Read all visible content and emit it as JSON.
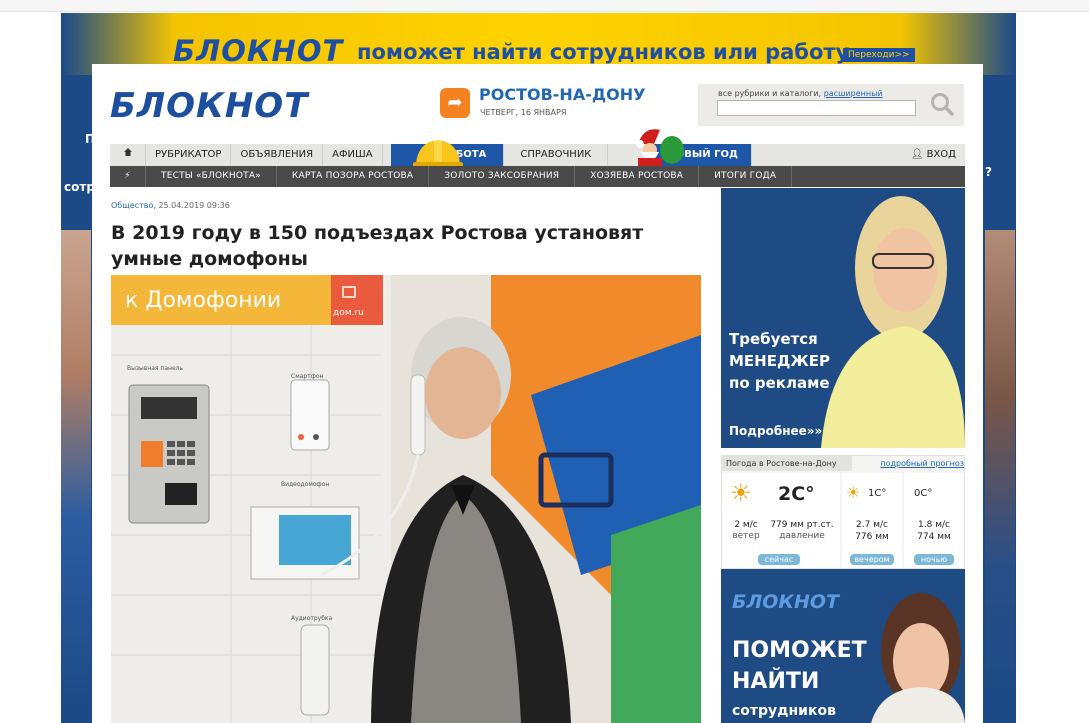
{
  "top_banner": {
    "logo": "БЛОКНОТ",
    "text": "поможет найти сотрудников или работу",
    "button": "Переходи>>"
  },
  "side_texts": {
    "left_1": "П",
    "left_2": "сотр",
    "right_1": "?"
  },
  "header": {
    "logo": "БЛОКНОТ",
    "city": "РОСТОВ-НА-ДОНУ",
    "date": "ЧЕТВЕРГ, 16 ЯНВАРЯ",
    "search_hint": "все рубрики и каталоги,",
    "search_link": "расширенный"
  },
  "nav1": {
    "items": [
      "РУБРИКАТОР",
      "ОБЪЯВЛЕНИЯ",
      "АФИША",
      "РАБОТА",
      "СПРАВОЧНИК",
      "НОВЫЙ ГОД",
      "ВХОД"
    ]
  },
  "nav2": {
    "items": [
      "ТЕСТЫ «БЛОКНОТА»",
      "КАРТА ПОЗОРА РОСТОВА",
      "ЗОЛОТО ЗАКСОБРАНИЯ",
      "ХОЗЯЕВА РОСТОВА",
      "ИТОГИ ГОДА"
    ]
  },
  "article": {
    "category": "Общество,",
    "datetime": "25.04.2019 09:36",
    "title": "В 2019 году в 150 подъездах Ростова установят умные домофоны",
    "photo": {
      "sign": "к Домофонии",
      "badge": "дом.ru",
      "labels": [
        "Вызывная панель",
        "Смартфон",
        "Видеодомофон",
        "Аудиотрубка"
      ]
    }
  },
  "ad1": {
    "line1": "Требуется",
    "line2": "МЕНЕДЖЕР",
    "line3": "по рекламе",
    "more": "Подробнее»»"
  },
  "weather": {
    "title": "Погода в Ростове-на-Дону",
    "link": "подробный прогноз",
    "now": {
      "temp": "2C°",
      "wind": "2 м/с",
      "wind_label": "ветер",
      "pressure": "779 мм рт.ст.",
      "pressure_label": "давление",
      "tag": "сейчас"
    },
    "evening": {
      "temp": "1C°",
      "wind": "2.7 м/с",
      "pressure": "776 мм",
      "tag": "вечером"
    },
    "night": {
      "temp": "0C°",
      "wind": "1.8 м/с",
      "pressure": "774 мм",
      "tag": "ночью"
    }
  },
  "ad2": {
    "logo": "БЛОКНОТ",
    "line1": "ПОМОЖЕТ",
    "line2": "НАЙТИ",
    "line3": "сотрудников"
  }
}
